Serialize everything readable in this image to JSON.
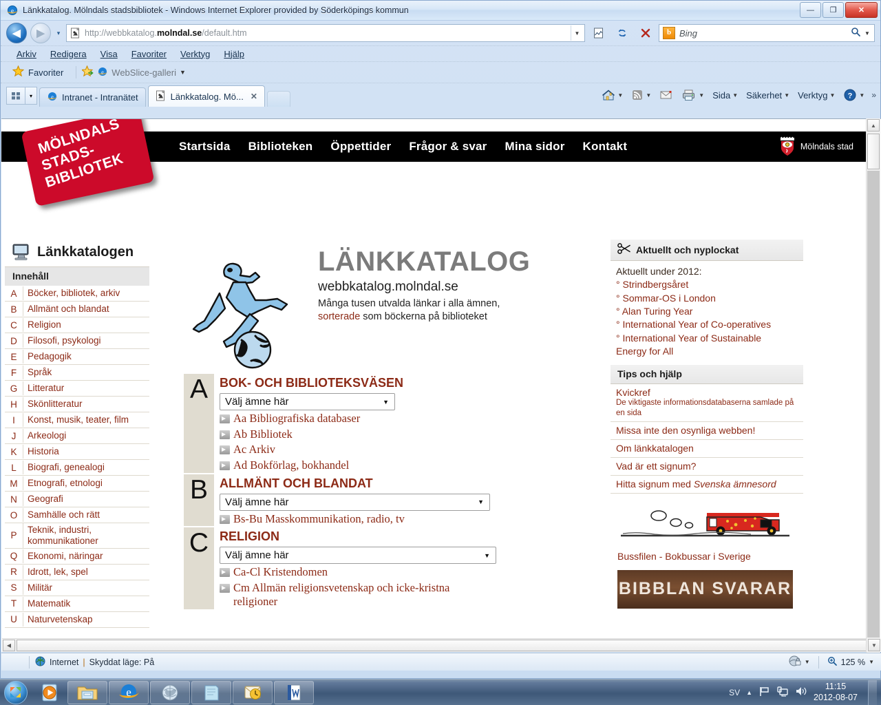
{
  "window": {
    "title": "Länkkatalog. Mölndals stadsbibliotek - Windows Internet Explorer provided by Söderköpings kommun",
    "minimize_label": "—",
    "maximize_label": "❐",
    "close_label": "✕"
  },
  "address": {
    "url_prefix": "http://webbkatalog.",
    "url_bold": "molndal.se",
    "url_suffix": "/default.htm",
    "back_label": "◀",
    "forward_label": "▶",
    "history_label": "▾",
    "dropdown_label": "▼",
    "compat_icon": "compatibility-view-icon",
    "refresh_label": "↻",
    "stop_label": "✕"
  },
  "search": {
    "provider": "b",
    "placeholder": "Bing",
    "magnifier": "search-icon",
    "dropdown_label": "▼"
  },
  "menubar": {
    "items": [
      "Arkiv",
      "Redigera",
      "Visa",
      "Favoriter",
      "Verktyg",
      "Hjälp"
    ]
  },
  "favbar": {
    "favorites_label": "Favoriter",
    "webslice_label": "WebSlice-galleri",
    "webslice_caret": "▼"
  },
  "tabs": {
    "quicktabs_label": "▤",
    "quicktabs_caret": "▾",
    "items": [
      {
        "label": "Intranet - Intranätet",
        "active": false,
        "icon": "ie-icon"
      },
      {
        "label": "Länkkatalog. Mö...",
        "active": true,
        "icon": "page-icon",
        "close": "✕"
      }
    ]
  },
  "commandbar": {
    "home_icon": "home-icon",
    "feeds_icon": "rss-icon",
    "mail_icon": "mail-icon",
    "print_icon": "printer-icon",
    "caret": "▼",
    "page_label": "Sida",
    "safety_label": "Säkerhet",
    "tools_label": "Verktyg",
    "help_icon": "help-icon",
    "overflow": "»"
  },
  "site": {
    "logo_lines": [
      "MÖLNDALS",
      "STADS-",
      "BIBLIOTEK"
    ],
    "nav": [
      "Startsida",
      "Biblioteken",
      "Öppettider",
      "Frågor & svar",
      "Mina sidor",
      "Kontakt"
    ],
    "crest_label": "Mölndals stad"
  },
  "left": {
    "heading": "Länkkatalogen",
    "heading_icon": "monitor-icon",
    "toc_label": "Innehåll",
    "categories": [
      {
        "key": "A",
        "label": "Böcker, bibliotek, arkiv"
      },
      {
        "key": "B",
        "label": "Allmänt och blandat"
      },
      {
        "key": "C",
        "label": "Religion"
      },
      {
        "key": "D",
        "label": "Filosofi, psykologi"
      },
      {
        "key": "E",
        "label": "Pedagogik"
      },
      {
        "key": "F",
        "label": "Språk"
      },
      {
        "key": "G",
        "label": "Litteratur"
      },
      {
        "key": "H",
        "label": "Skönlitteratur"
      },
      {
        "key": "I",
        "label": "Konst, musik, teater, film"
      },
      {
        "key": "J",
        "label": "Arkeologi"
      },
      {
        "key": "K",
        "label": "Historia"
      },
      {
        "key": "L",
        "label": "Biografi, genealogi"
      },
      {
        "key": "M",
        "label": "Etnografi, etnologi"
      },
      {
        "key": "N",
        "label": "Geografi"
      },
      {
        "key": "O",
        "label": "Samhälle och rätt"
      },
      {
        "key": "P",
        "label": "Teknik, industri, kommunikationer"
      },
      {
        "key": "Q",
        "label": "Ekonomi, näringar"
      },
      {
        "key": "R",
        "label": "Idrott, lek, spel"
      },
      {
        "key": "S",
        "label": "Militär"
      },
      {
        "key": "T",
        "label": "Matematik"
      },
      {
        "key": "U",
        "label": "Naturvetenskap"
      }
    ]
  },
  "main": {
    "hero_title": "LÄNKKATALOG",
    "hero_sub": "webbkatalog.molndal.se",
    "hero_desc_1": "Många tusen utvalda länkar i alla ämnen,",
    "hero_desc_red": "sorterade",
    "hero_desc_2": " som böckerna på biblioteket",
    "hero_art": "runner-and-globe-illustration",
    "select_placeholder": "Välj ämne här",
    "sections": [
      {
        "letter": "A",
        "title": "BOK- OCH BIBLIOTEKSVÄSEN",
        "links": [
          "Aa Bibliografiska databaser",
          "Ab Bibliotek",
          "Ac Arkiv",
          "Ad Bokförlag, bokhandel"
        ]
      },
      {
        "letter": "B",
        "title": "ALLMÄNT OCH BLANDAT",
        "links": [
          "Bs-Bu Masskommunikation, radio, tv"
        ]
      },
      {
        "letter": "C",
        "title": "RELIGION",
        "links": [
          "Ca-Cl Kristendomen",
          "Cm Allmän religionsvetenskap och icke-kristna religioner"
        ]
      }
    ]
  },
  "right": {
    "news": {
      "heading": "Aktuellt och nyplockat",
      "heading_icon": "scissors-icon",
      "intro": "Aktuellt under 2012:",
      "items": [
        "° Strindbergsåret",
        "° Sommar-OS i London",
        "° Alan Turing Year",
        "° International Year of Co-operatives",
        "° International Year of Sustainable",
        "Energy for All"
      ]
    },
    "tips": {
      "heading": "Tips och hjälp",
      "items": [
        {
          "label": "Kvickref",
          "sub": "De viktigaste informationsdatabaserna samlade på en sida"
        },
        {
          "label": "Missa inte den osynliga webben!"
        },
        {
          "label": "Om länkkatalogen"
        },
        {
          "label": "Vad är ett signum?"
        },
        {
          "label_pre": "Hitta signum med ",
          "label_italic": "Svenska ämnesord"
        }
      ]
    },
    "bus": {
      "image": "bookbus-illustration",
      "caption": "Bussfilen - Bokbussar i Sverige"
    },
    "banner": {
      "text": "BIBBLAN SVARAR",
      "image": "bibblan-svarar-banner"
    }
  },
  "statusbar": {
    "zone_icon": "globe-icon",
    "zone_text": "Internet",
    "separator": "|",
    "protected_text": "Skyddat läge: På",
    "privacy_icon": "privacy-icon",
    "caret": "▼",
    "zoom_icon": "zoom-icon",
    "zoom_level": "125 %"
  },
  "taskbar": {
    "start_label": "start-orb",
    "items": [
      "media-player-icon",
      "explorer-icon",
      "internet-explorer-icon",
      "globe-app-icon",
      "notepad-icon",
      "outlook-icon",
      "word-icon"
    ],
    "tray": {
      "language": "SV",
      "show_hidden": "▲",
      "flag_icon": "flag-icon",
      "network_icon": "network-icon",
      "volume_icon": "volume-icon",
      "time": "11:15",
      "date": "2012-08-07"
    }
  }
}
